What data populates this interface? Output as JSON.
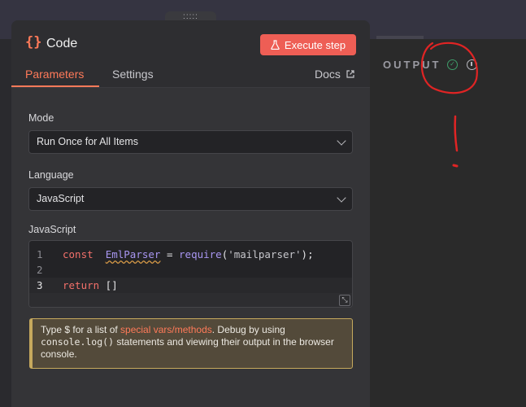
{
  "node": {
    "icon_text": "{}",
    "title": "Code",
    "execute_label": "Execute step"
  },
  "tabs": [
    {
      "label": "Parameters"
    },
    {
      "label": "Settings"
    },
    {
      "label": "Docs"
    }
  ],
  "mode": {
    "label": "Mode",
    "value": "Run Once for All Items"
  },
  "language": {
    "label": "Language",
    "value": "JavaScript"
  },
  "editor": {
    "label": "JavaScript",
    "lines": [
      {
        "num": "1",
        "kw": "const",
        "id": "EmlParser",
        "op": " = ",
        "fn": "require",
        "open": "(",
        "str": "'mailparser'",
        "close": ");"
      },
      {
        "num": "2"
      },
      {
        "num": "3",
        "kw": "return",
        "rest": " []"
      }
    ]
  },
  "hint": {
    "pre": "Type $ for a list of ",
    "accent": "special vars/methods",
    "mid": ". Debug by using ",
    "code": "console.log()",
    "post": " statements and viewing their output in the browser console."
  },
  "output": {
    "label": "OUTPUT"
  },
  "colors": {
    "accent": "#ff7a59",
    "execute": "#ee5e55",
    "success": "#3f9e6a",
    "annotation": "#e02424"
  }
}
